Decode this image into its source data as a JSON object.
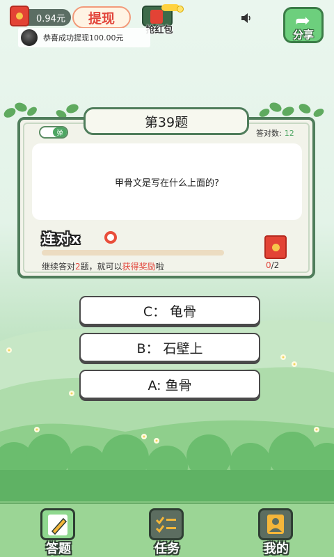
{
  "header": {
    "balance": "0.94元",
    "withdraw_label": "提现",
    "grab_redpack_label": "抢红包",
    "share_label": "分享"
  },
  "toast": {
    "message": "恭喜成功提现100.00元"
  },
  "quiz": {
    "title": "第39题",
    "toggle_label": "弹",
    "correct_count_label": "答对数:",
    "correct_count_value": "12",
    "question": "甲骨文是写在什么上面的?",
    "combo_label": "连对x",
    "combo_value": "0",
    "progress_fraction": 0,
    "hint_prefix": "继续答对",
    "hint_count": "2",
    "hint_middle": "题，就可以",
    "hint_reward": "获得奖励",
    "hint_suffix": "啦",
    "reward_current": "0",
    "reward_total": "/2"
  },
  "answers": [
    {
      "label": "C：  龟骨"
    },
    {
      "label": "B：  石壁上"
    },
    {
      "label": "A: 鱼骨"
    }
  ],
  "nav": {
    "answer_label": "答题",
    "tasks_label": "任务",
    "mine_label": "我的"
  },
  "colors": {
    "accent_green": "#4ea663",
    "highlight_red": "#e2453b",
    "card_border": "#4f7d5b"
  }
}
